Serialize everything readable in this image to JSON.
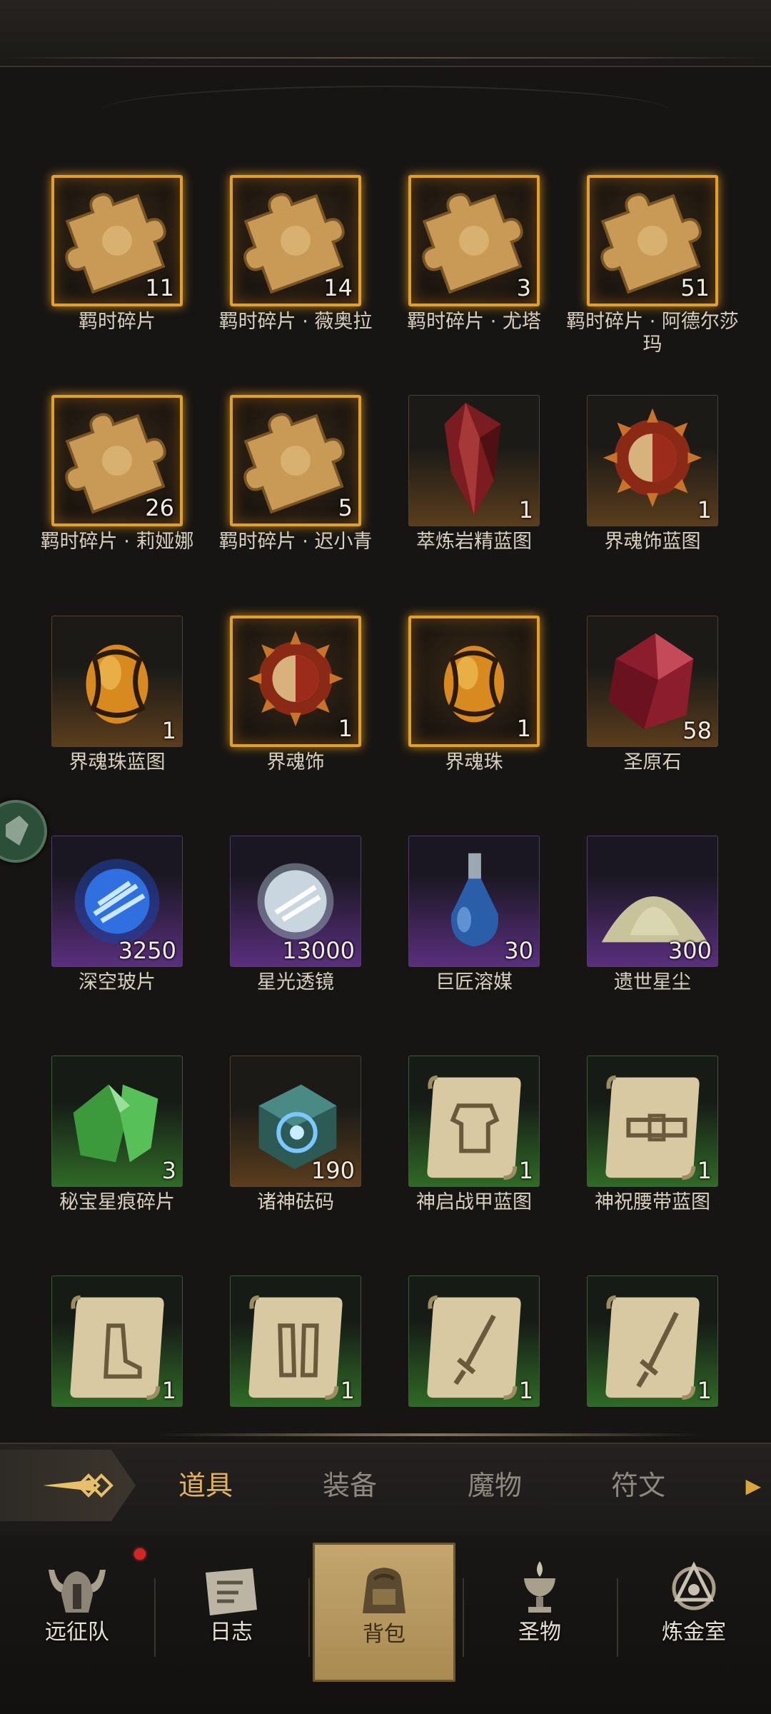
{
  "inventory": {
    "items": [
      {
        "name": "羁时碎片",
        "count": "11",
        "rarity": "legend",
        "icon": "puzzle-piece-icon"
      },
      {
        "name": "羁时碎片 · 薇奥拉",
        "count": "14",
        "rarity": "legend",
        "icon": "puzzle-piece-icon"
      },
      {
        "name": "羁时碎片 · 尤塔",
        "count": "3",
        "rarity": "legend",
        "icon": "puzzle-piece-icon"
      },
      {
        "name": "羁时碎片 · 阿德尔莎玛",
        "count": "51",
        "rarity": "legend",
        "icon": "puzzle-piece-icon"
      },
      {
        "name": "羁时碎片 · 莉娅娜",
        "count": "26",
        "rarity": "legend",
        "icon": "puzzle-piece-icon"
      },
      {
        "name": "羁时碎片 · 迟小青",
        "count": "5",
        "rarity": "legend",
        "icon": "puzzle-piece-icon"
      },
      {
        "name": "萃炼岩精蓝图",
        "count": "1",
        "rarity": "orange",
        "icon": "red-crystal-icon"
      },
      {
        "name": "界魂饰蓝图",
        "count": "1",
        "rarity": "orange",
        "icon": "sun-mask-icon"
      },
      {
        "name": "界魂珠蓝图",
        "count": "1",
        "rarity": "orange",
        "icon": "amber-orb-icon"
      },
      {
        "name": "界魂饰",
        "count": "1",
        "rarity": "legend",
        "icon": "sun-mask-icon"
      },
      {
        "name": "界魂珠",
        "count": "1",
        "rarity": "legend",
        "icon": "amber-orb-icon"
      },
      {
        "name": "圣原石",
        "count": "58",
        "rarity": "orange",
        "icon": "ruby-stone-icon"
      },
      {
        "name": "深空玻片",
        "count": "3250",
        "rarity": "purple",
        "icon": "blue-orb-icon"
      },
      {
        "name": "星光透镜",
        "count": "13000",
        "rarity": "purple",
        "icon": "silver-orb-icon"
      },
      {
        "name": "巨匠溶媒",
        "count": "30",
        "rarity": "purple",
        "icon": "potion-flask-icon"
      },
      {
        "name": "遗世星尘",
        "count": "300",
        "rarity": "purple",
        "icon": "dust-pile-icon"
      },
      {
        "name": "秘宝星痕碎片",
        "count": "3",
        "rarity": "green",
        "icon": "green-crystal-icon"
      },
      {
        "name": "诸神砝码",
        "count": "190",
        "rarity": "orange",
        "icon": "rune-cube-icon"
      },
      {
        "name": "神启战甲蓝图",
        "count": "1",
        "rarity": "green",
        "icon": "armor-scroll-icon"
      },
      {
        "name": "神祝腰带蓝图",
        "count": "1",
        "rarity": "green",
        "icon": "belt-scroll-icon"
      },
      {
        "name": "",
        "count": "1",
        "rarity": "green",
        "icon": "boots-scroll-icon"
      },
      {
        "name": "",
        "count": "1",
        "rarity": "green",
        "icon": "greaves-scroll-icon"
      },
      {
        "name": "",
        "count": "1",
        "rarity": "green",
        "icon": "sword-scroll-icon"
      },
      {
        "name": "",
        "count": "1",
        "rarity": "green",
        "icon": "blade-scroll-icon"
      }
    ]
  },
  "tabs": {
    "items": [
      "道具",
      "装备",
      "魔物",
      "符文"
    ],
    "active": 0
  },
  "nav": {
    "items": [
      {
        "label": "远征队",
        "icon": "viking-helmet-icon"
      },
      {
        "label": "日志",
        "icon": "journal-icon"
      },
      {
        "label": "背包",
        "icon": "backpack-icon"
      },
      {
        "label": "圣物",
        "icon": "chalice-icon"
      },
      {
        "label": "炼金室",
        "icon": "alchemy-icon"
      }
    ],
    "active": 2,
    "badge_on": "远征队"
  },
  "colors": {
    "legend_border": "#e0a02c",
    "active_tab": "#e2b35a",
    "orange": "#5a3d1c",
    "purple": "#5a2f7e",
    "green": "#2f6a26",
    "notification": "#d32626"
  }
}
